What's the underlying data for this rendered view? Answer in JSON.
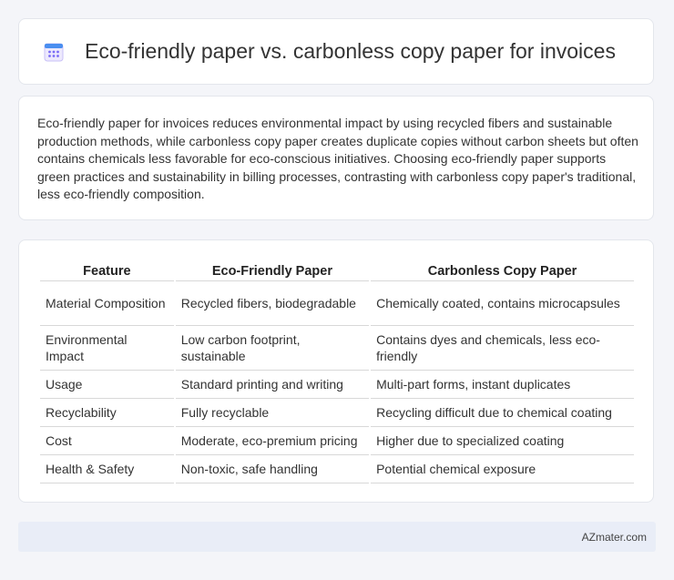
{
  "header": {
    "icon": "calendar-grid-icon",
    "title": "Eco-friendly paper vs. carbonless copy paper for invoices"
  },
  "summary": {
    "text": "Eco-friendly paper for invoices reduces environmental impact by using recycled fibers and sustainable production methods, while carbonless copy paper creates duplicate copies without carbon sheets but often contains chemicals less favorable for eco-conscious initiatives. Choosing eco-friendly paper supports green practices and sustainability in billing processes, contrasting with carbonless copy paper's traditional, less eco-friendly composition."
  },
  "table": {
    "headers": [
      "Feature",
      "Eco-Friendly Paper",
      "Carbonless Copy Paper"
    ],
    "rows": [
      [
        "Material Composition",
        "Recycled fibers, biodegradable",
        "Chemically coated, contains microcapsules"
      ],
      [
        "Environmental Impact",
        "Low carbon footprint, sustainable",
        "Contains dyes and chemicals, less eco-friendly"
      ],
      [
        "Usage",
        "Standard printing and writing",
        "Multi-part forms, instant duplicates"
      ],
      [
        "Recyclability",
        "Fully recyclable",
        "Recycling difficult due to chemical coating"
      ],
      [
        "Cost",
        "Moderate, eco-premium pricing",
        "Higher due to specialized coating"
      ],
      [
        "Health & Safety",
        "Non-toxic, safe handling",
        "Potential chemical exposure"
      ]
    ]
  },
  "footer": {
    "brand": "AZmater.com"
  },
  "colors": {
    "icon_accent": "#7b6cf6",
    "icon_header": "#4a8ef0",
    "footer_bg": "#e9edf7"
  }
}
